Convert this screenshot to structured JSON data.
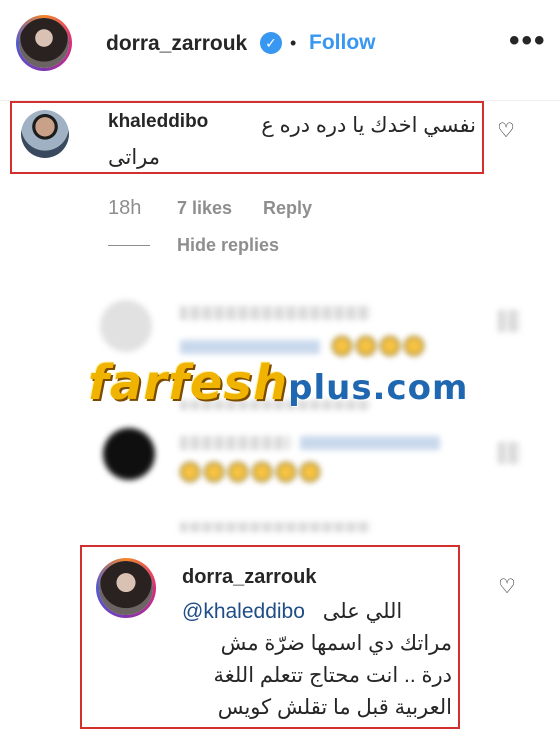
{
  "header": {
    "username": "dorra_zarrouk",
    "separator": "•",
    "follow_label": "Follow",
    "more_icon": "•••",
    "verified_icon": "✓"
  },
  "comment1": {
    "username": "khaleddibo",
    "text_line1": "نفسي اخدك يا دره دره ع",
    "text_line2": "مراتى",
    "time": "18h",
    "likes": "7 likes",
    "reply_label": "Reply",
    "hide_replies": "Hide replies"
  },
  "watermark": {
    "main": "farfesh",
    "suffix": "plus.com"
  },
  "comment4": {
    "username": "dorra_zarrouk",
    "mention": "@khaleddibo",
    "line1_tail": "اللي على",
    "line2": "مراتك دي اسمها ضرّة مش",
    "line3": "درة .. انت محتاج تتعلم اللغة",
    "line4": "العربية قبل ما تقلش كويس"
  },
  "icons": {
    "heart": "heart-outline-icon"
  }
}
